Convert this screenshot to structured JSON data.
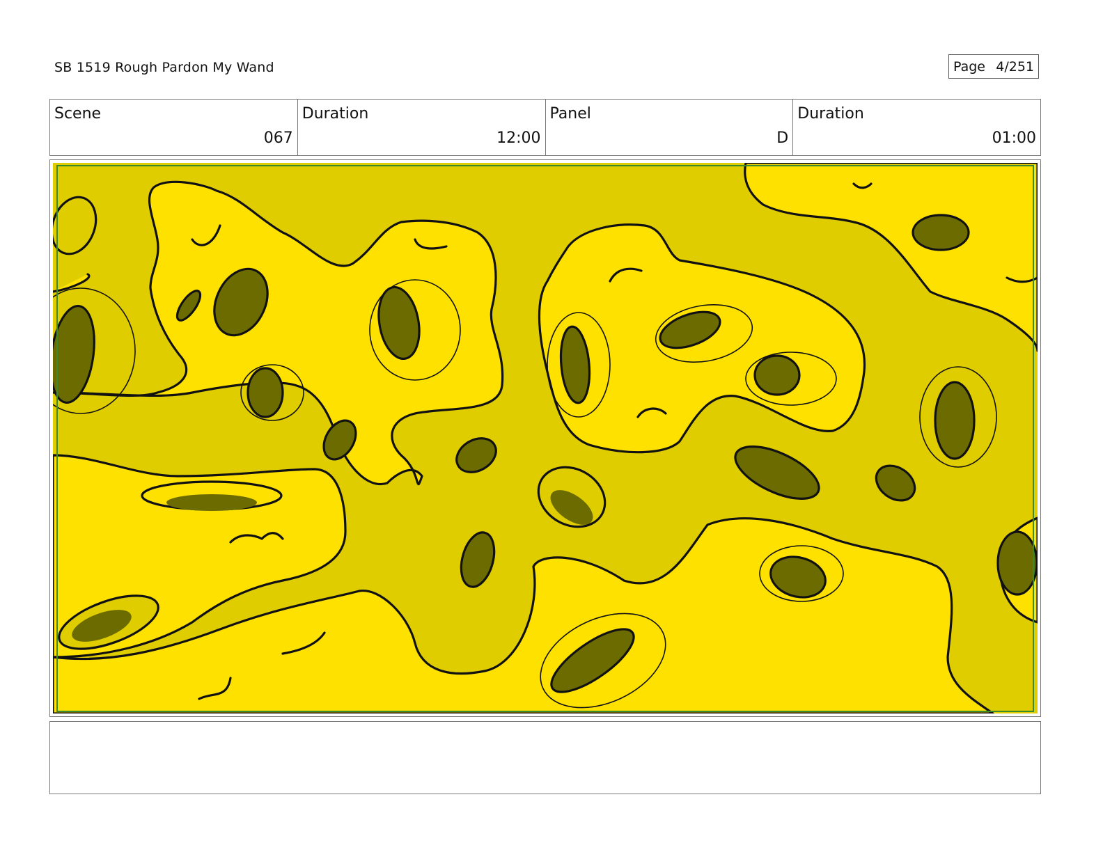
{
  "header": {
    "title": "SB 1519 Rough  Pardon My Wand",
    "page_label": "Page",
    "page_number": "4/251"
  },
  "info": {
    "scene_label": "Scene",
    "scene_value": "067",
    "scene_duration_label": "Duration",
    "scene_duration_value": "12:00",
    "panel_label": "Panel",
    "panel_value": "D",
    "panel_duration_label": "Duration",
    "panel_duration_value": "01:00"
  },
  "panel": {
    "colors": {
      "background": "#e0cd00",
      "blob": "#ffe100",
      "crater": "#6b6b00",
      "ink": "#111111",
      "safe_frame": "#3b8a2a"
    }
  },
  "notes": {
    "text": ""
  }
}
